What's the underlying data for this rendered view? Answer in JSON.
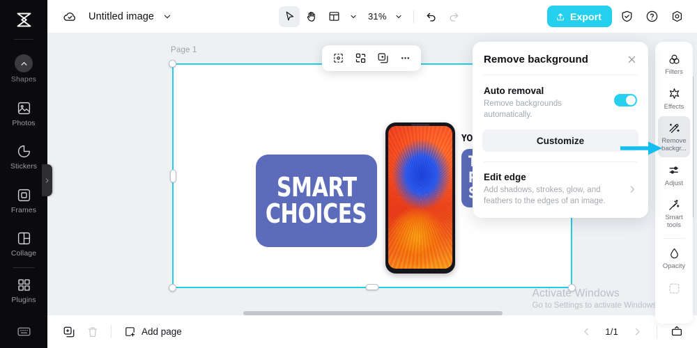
{
  "app": {
    "logo": "capcut-logo",
    "cloud_icon": "cloud-check-icon",
    "doc_title": "Untitled image",
    "title_caret": "chevron-down-icon"
  },
  "toolbar": {
    "select_tool": "cursor-arrow-icon",
    "hand_tool": "hand-icon",
    "layout_tool": "layout-icon",
    "layout_caret": "chevron-down-icon",
    "zoom_value": "31%",
    "zoom_caret": "chevron-down-icon",
    "undo": "undo-icon",
    "redo": "redo-icon",
    "export_label": "Export",
    "export_icon": "upload-icon",
    "shield_icon": "shield-check-icon",
    "help_icon": "question-circle-icon",
    "settings_icon": "gear-icon",
    "accent_color": "#25d0ee"
  },
  "sidebar": {
    "items": [
      {
        "label": "Shapes",
        "icon": "chevron-up-circle-icon"
      },
      {
        "label": "Photos",
        "icon": "photo-icon"
      },
      {
        "label": "Stickers",
        "icon": "sticker-icon"
      },
      {
        "label": "Frames",
        "icon": "frame-icon"
      },
      {
        "label": "Collage",
        "icon": "collage-icon"
      },
      {
        "label": "Plugins",
        "icon": "plugins-icon"
      }
    ],
    "keyboard_icon": "keyboard-icon",
    "collapse_icon": "chevron-right-icon"
  },
  "canvas": {
    "page_label": "Page 1",
    "object_toolbar": [
      {
        "icon": "cutout-icon"
      },
      {
        "icon": "qr-layout-icon"
      },
      {
        "icon": "duplicate-layer-icon"
      },
      {
        "icon": "more-options-icon"
      }
    ],
    "design": {
      "headline_line1": "SMART",
      "headline_line2": "CHOICES",
      "kicker": "YOUR ULTIMA",
      "subhead_line1": "TO SELECT",
      "subhead_line2": "PERFECT",
      "subhead_line3": "SMARTPHO",
      "card_color": "#5c6cba",
      "phone_image": "smartphone-colorful-wallpaper"
    },
    "selection_color": "#20cfe8"
  },
  "remove_bg_panel": {
    "title": "Remove background",
    "close_icon": "close-icon",
    "auto_removal": {
      "title": "Auto removal",
      "description": "Remove backgrounds automatically.",
      "toggle_on": true,
      "toggle_color": "#25d0ee"
    },
    "customize_label": "Customize",
    "edit_edge": {
      "title": "Edit edge",
      "description": "Add shadows, strokes, glow, and feathers to the edges of an image.",
      "chevron_icon": "chevron-right-icon"
    }
  },
  "right_rail": {
    "items": [
      {
        "label": "Filters",
        "icon": "filters-icon",
        "selected": false
      },
      {
        "label": "Effects",
        "icon": "effects-icon",
        "selected": false
      },
      {
        "label": "Remove backgr...",
        "icon": "remove-background-icon",
        "selected": true
      },
      {
        "label": "Adjust",
        "icon": "adjust-sliders-icon",
        "selected": false
      },
      {
        "label": "Smart tools",
        "icon": "smart-tools-icon",
        "selected": false
      },
      {
        "label": "Opacity",
        "icon": "opacity-droplet-icon",
        "selected": false
      }
    ]
  },
  "footer": {
    "duplicate_icon": "duplicate-page-icon",
    "delete_icon": "trash-icon",
    "add_page_label": "Add page",
    "add_page_icon": "add-page-icon",
    "prev_icon": "chevron-left-icon",
    "next_icon": "chevron-right-icon",
    "page_counter": "1/1",
    "fit_icon": "fit-screen-icon"
  },
  "watermark": {
    "line1": "Activate Windows",
    "line2": "Go to Settings to activate Windows."
  },
  "annotation": {
    "arrow": "cyan-pointer-arrow"
  }
}
